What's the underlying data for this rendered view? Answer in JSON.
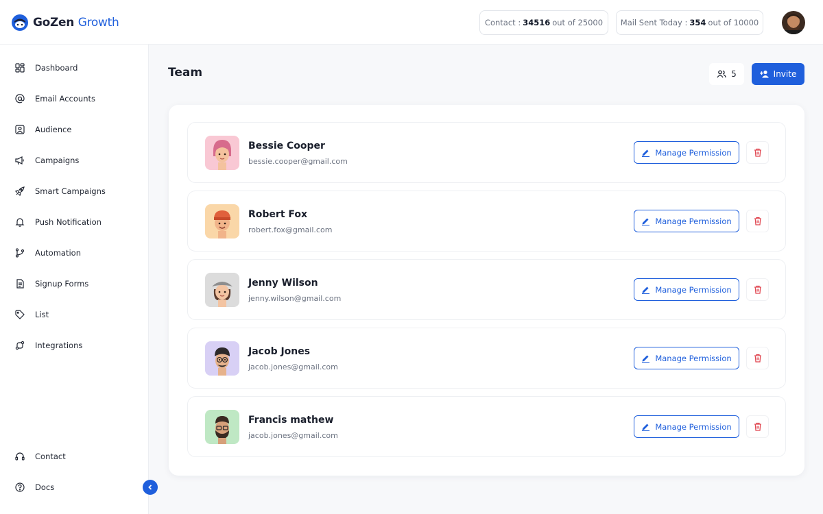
{
  "brand": {
    "name_part1": "GoZen",
    "name_part2": "Growth"
  },
  "stats": {
    "contact": {
      "label": "Contact :",
      "value": "34516",
      "suffix": "out of 25000"
    },
    "mail": {
      "label": "Mail Sent Today :",
      "value": "354",
      "suffix": "out of 10000"
    }
  },
  "sidebar": {
    "items": [
      {
        "label": "Dashboard",
        "icon": "dashboard-icon"
      },
      {
        "label": "Email Accounts",
        "icon": "at-icon"
      },
      {
        "label": "Audience",
        "icon": "audience-icon"
      },
      {
        "label": "Campaigns",
        "icon": "megaphone-icon"
      },
      {
        "label": "Smart Campaigns",
        "icon": "rocket-icon"
      },
      {
        "label": "Push Notification",
        "icon": "bell-icon"
      },
      {
        "label": "Automation",
        "icon": "branch-icon"
      },
      {
        "label": "Signup Forms",
        "icon": "form-icon"
      },
      {
        "label": "List",
        "icon": "tag-icon"
      },
      {
        "label": "Integrations",
        "icon": "integration-icon"
      }
    ],
    "bottom": [
      {
        "label": "Contact",
        "icon": "headset-icon"
      },
      {
        "label": "Docs",
        "icon": "help-icon"
      }
    ]
  },
  "main": {
    "title": "Team",
    "member_count": "5",
    "invite_label": "Invite",
    "manage_label": "Manage Permission",
    "members": [
      {
        "name": "Bessie Cooper",
        "email": "bessie.cooper@gmail.com",
        "bg": "#f9c8d4",
        "skin": "#f4c29e",
        "hair": "#d76b8c"
      },
      {
        "name": "Robert Fox",
        "email": "robert.fox@gmail.com",
        "bg": "#fad7a8",
        "skin": "#f1b48a",
        "hair": "#e0603c"
      },
      {
        "name": "Jenny Wilson",
        "email": "jenny.wilson@gmail.com",
        "bg": "#dcdcdc",
        "skin": "#f3c4a2",
        "hair": "#8e8e8e"
      },
      {
        "name": "Jacob Jones",
        "email": "jacob.jones@gmail.com",
        "bg": "#d8d0f5",
        "skin": "#e6b28c",
        "hair": "#2d2a2a"
      },
      {
        "name": "Francis mathew",
        "email": "jacob.jones@gmail.com",
        "bg": "#bfe8c4",
        "skin": "#d6a07a",
        "hair": "#3a2a22"
      }
    ]
  },
  "colors": {
    "accent": "#1f5fdc",
    "danger": "#e0454f"
  }
}
